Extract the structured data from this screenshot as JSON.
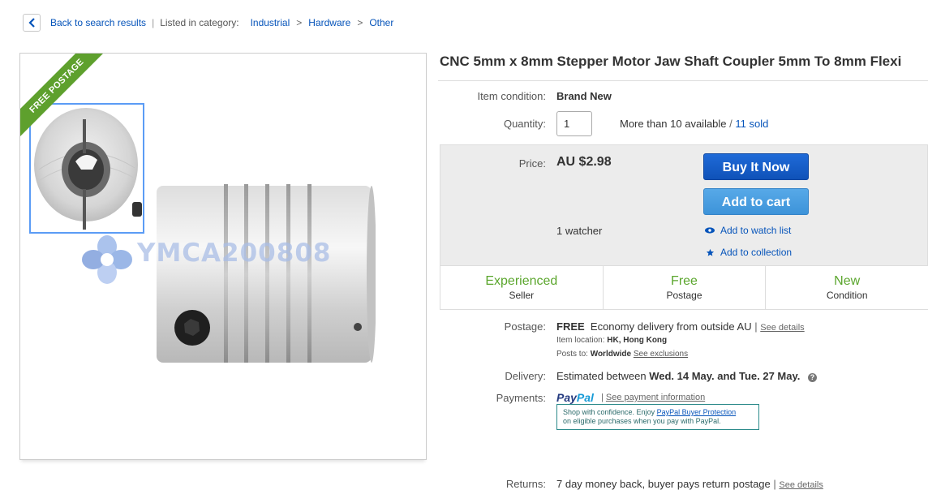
{
  "breadcrumb": {
    "back_label": "Back to search results",
    "listed_label": "Listed in category:",
    "categories": [
      "Industrial",
      "Hardware",
      "Other"
    ]
  },
  "gallery": {
    "ribbon": "FREE POSTAGE",
    "watermark": "YMCA200808"
  },
  "item": {
    "title": "CNC 5mm x 8mm Stepper Motor Jaw Shaft Coupler 5mm To 8mm Flexi",
    "condition_label": "Item condition:",
    "condition_value": "Brand New",
    "quantity_label": "Quantity:",
    "quantity_value": "1",
    "availability": "More than 10 available",
    "availability_sep": "/",
    "sold": "11 sold"
  },
  "price": {
    "label": "Price:",
    "value": "AU $2.98",
    "buy_now": "Buy It Now",
    "add_to_cart": "Add to cart",
    "watchers": "1 watcher",
    "watch_list": "Add to watch list",
    "collection": "Add to collection"
  },
  "badges": [
    {
      "main": "Experienced",
      "sub": "Seller"
    },
    {
      "main": "Free",
      "sub": "Postage"
    },
    {
      "main": "New",
      "sub": "Condition"
    }
  ],
  "postage": {
    "label": "Postage:",
    "free": "FREE",
    "method": "Economy delivery from outside AU",
    "see_details": "See details",
    "location_label": "Item location:",
    "location_value": "HK, Hong Kong",
    "posts_label": "Posts to:",
    "posts_value": "Worldwide",
    "exclusions": "See exclusions"
  },
  "delivery": {
    "label": "Delivery:",
    "prefix": "Estimated between",
    "dates": "Wed. 14 May. and Tue. 27 May."
  },
  "payments": {
    "label": "Payments:",
    "logo_pay": "Pay",
    "logo_pal": "Pal",
    "see_info": "See payment information",
    "box_line1_prefix": "Shop with confidence. Enjoy",
    "box_link": "PayPal Buyer Protection",
    "box_line2": "on eligible purchases when you pay with PayPal."
  },
  "returns": {
    "label": "Returns:",
    "value": "7 day money back, buyer pays return postage",
    "see_details": "See details"
  },
  "colors": {
    "link": "#0654ba",
    "badge_green": "#5ba62d",
    "buy_button": "#1f6ad8",
    "cart_button": "#4b9fe1",
    "ribbon": "#5ea02d"
  }
}
